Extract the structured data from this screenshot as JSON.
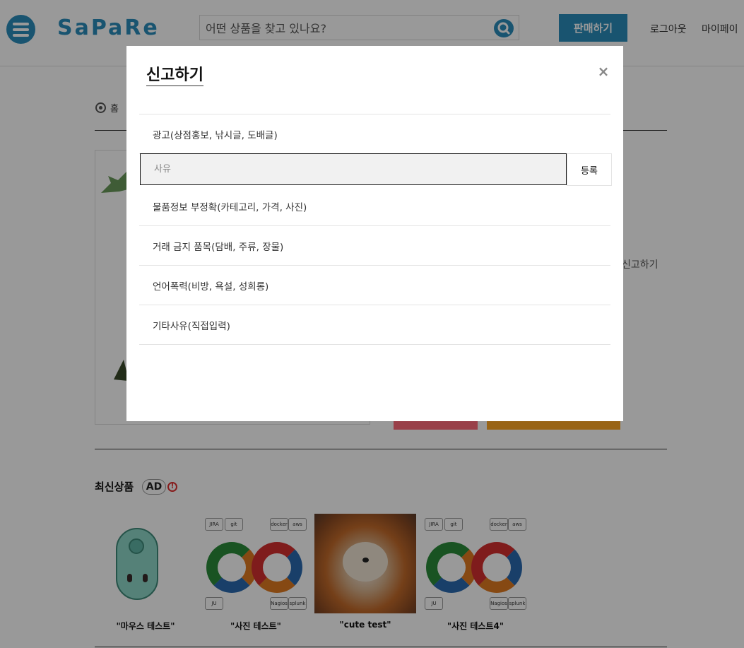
{
  "header": {
    "logo": "SaPaRe",
    "search_placeholder": "어떤 상품을 찾고 있나요?",
    "sell_label": "판매하기",
    "logout_label": "로그아웃",
    "mypage_label": "마이페이"
  },
  "breadcrumb": {
    "home": "홈"
  },
  "detail": {
    "report_link": "신고하기"
  },
  "latest": {
    "title": "최신상품",
    "ad_badge": "AD",
    "info_glyph": "!",
    "items": [
      {
        "name": "\"마우스 테스트\""
      },
      {
        "name": "\"사진 테스트\""
      },
      {
        "name": "\"cute test\""
      },
      {
        "name": "\"사진 테스트4\""
      }
    ],
    "devops_tags": [
      "JIRA",
      "git",
      "docker",
      "aws",
      "JU",
      "Nagios",
      "splunk"
    ]
  },
  "modal": {
    "title": "신고하기",
    "close_glyph": "×",
    "reasons": [
      "광고(상점홍보, 낚시글, 도배글)",
      "물품정보 부정확(카테고리, 가격, 사진)",
      "거래 금지 품목(담배, 주류, 장물)",
      "언어폭력(비방, 욕설, 성희롱)",
      "기타사유(직접입력)"
    ],
    "input_placeholder": "사유",
    "register_label": "등록"
  },
  "colors": {
    "brand": "#2a8dbb",
    "overlay": "rgba(0,0,0,0.4)"
  }
}
